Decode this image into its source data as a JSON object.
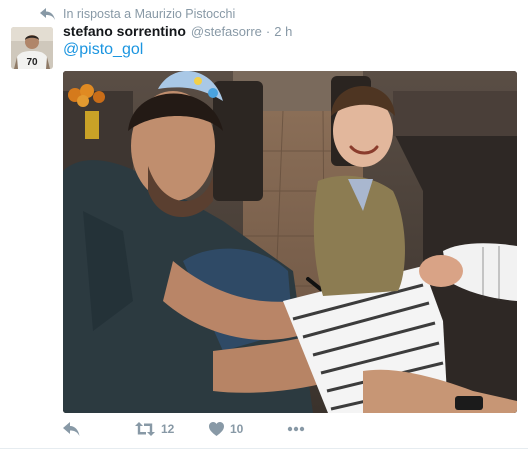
{
  "reply_context": {
    "text": "In risposta a Maurizio Pistocchi"
  },
  "author": {
    "fullname": "stefano sorrentino",
    "screen_name": "@stefasorre",
    "separator": "·",
    "time": "2 h",
    "avatar_jersey_number": "70"
  },
  "tweet": {
    "mention": "@pisto_gol"
  },
  "actions": {
    "retweet_count": "12",
    "like_count": "10"
  },
  "colors": {
    "link": "#1b95e0",
    "muted": "#8899a6",
    "text": "#14171a"
  },
  "icons": [
    "reply-icon",
    "retweet-icon",
    "heart-icon",
    "more-icon"
  ]
}
